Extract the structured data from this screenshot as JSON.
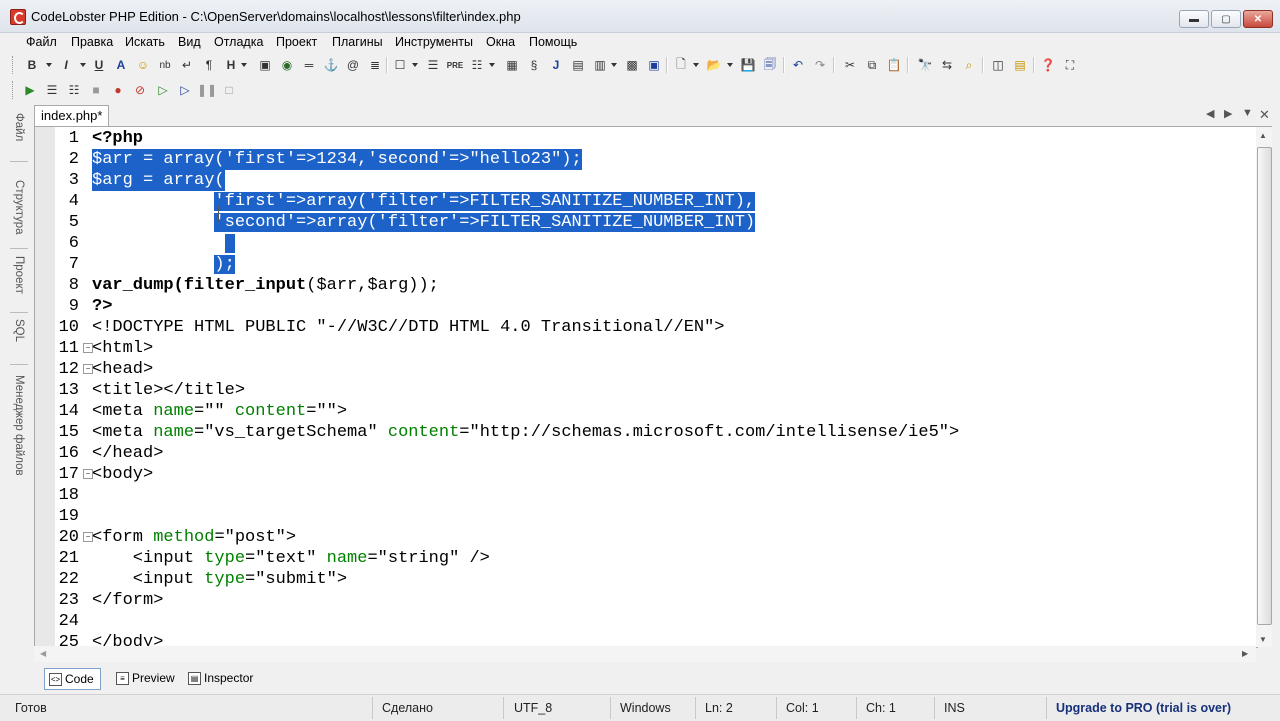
{
  "window": {
    "title": "CodeLobster PHP Edition - C:\\OpenServer\\domains\\localhost\\lessons\\filter\\index.php",
    "minimize": "▬",
    "maximize": "▢",
    "close": "✕"
  },
  "menu": [
    {
      "label": "Файл"
    },
    {
      "label": "Правка"
    },
    {
      "label": "Искать"
    },
    {
      "label": "Вид"
    },
    {
      "label": "Отладка"
    },
    {
      "label": "Проект"
    },
    {
      "label": "Плагины"
    },
    {
      "label": "Инструменты"
    },
    {
      "label": "Окна"
    },
    {
      "label": "Помощь"
    }
  ],
  "format_toolbar": {
    "bold": "B",
    "italic": "I",
    "underline": "U",
    "font": "A",
    "nbsp": "nb",
    "paragraph": "¶",
    "heading": "H"
  },
  "side_tabs": [
    "Файл",
    "Структура",
    "Проект",
    "SQL",
    "Менеджер файлов"
  ],
  "editor": {
    "tab_label": "index.php*",
    "lines": [
      {
        "n": "1"
      },
      {
        "n": "2"
      },
      {
        "n": "3"
      },
      {
        "n": "4"
      },
      {
        "n": "5"
      },
      {
        "n": "6"
      },
      {
        "n": "7"
      },
      {
        "n": "8"
      },
      {
        "n": "9"
      },
      {
        "n": "10"
      },
      {
        "n": "11"
      },
      {
        "n": "12"
      },
      {
        "n": "13"
      },
      {
        "n": "14"
      },
      {
        "n": "15"
      },
      {
        "n": "16"
      },
      {
        "n": "17"
      },
      {
        "n": "18"
      },
      {
        "n": "19"
      },
      {
        "n": "20"
      },
      {
        "n": "21"
      },
      {
        "n": "22"
      },
      {
        "n": "23"
      },
      {
        "n": "24"
      },
      {
        "n": "25"
      }
    ],
    "code": {
      "l1": "<?php",
      "l2": "$arr = array('first'=>1234,'second'=>\"hello23\");",
      "l3": "$arg = array(",
      "l4_indent": "            ",
      "l4": "'first'=>array('filter'=>FILTER_SANITIZE_NUMBER_INT),",
      "l5_indent": "            ",
      "l5": "'second'=>array('filter'=>FILTER_SANITIZE_NUMBER_INT)",
      "l6": "             ",
      "l7_indent": "            ",
      "l7": ");",
      "l8a": "var_dump(",
      "l8b": "filter_input",
      "l8c": "($arr,$arg));",
      "l9": "?>",
      "l10": "<!DOCTYPE HTML PUBLIC \"-//W3C//DTD HTML 4.0 Transitional//EN\">",
      "l11": "<html>",
      "l12": "<head>",
      "l13": "<title></title>",
      "l14a": "<meta ",
      "l14b": "name",
      "l14c": "=\"\" ",
      "l14d": "content",
      "l14e": "=\"\">",
      "l15a": "<meta ",
      "l15b": "name",
      "l15c": "=\"vs_targetSchema\" ",
      "l15d": "content",
      "l15e": "=\"http://schemas.microsoft.com/intellisense/ie5\">",
      "l16": "</head>",
      "l17": "<body>",
      "l18": "",
      "l19": "",
      "l20a": "<form ",
      "l20b": "method",
      "l20c": "=\"post\">",
      "l21a": "    <input ",
      "l21b": "type",
      "l21c": "=\"text\" ",
      "l21d": "name",
      "l21e": "=\"string\" />",
      "l22a": "    <input ",
      "l22b": "type",
      "l22c": "=\"submit\">",
      "l23": "</form>",
      "l24": "",
      "l25": "</body>"
    }
  },
  "view_tabs": [
    {
      "label": "Code"
    },
    {
      "label": "Preview"
    },
    {
      "label": "Inspector"
    }
  ],
  "status": {
    "ready": "Готов",
    "done": "Сделано",
    "encoding": "UTF_8",
    "eol": "Windows",
    "ln": "Ln: 2",
    "col": "Col: 1",
    "ch": "Ch: 1",
    "mode": "INS",
    "upgrade": "Upgrade to PRO (trial is over)"
  },
  "colors": {
    "selection": "#1d62c8",
    "attribute": "#008000",
    "upgrade": "#17307a"
  }
}
